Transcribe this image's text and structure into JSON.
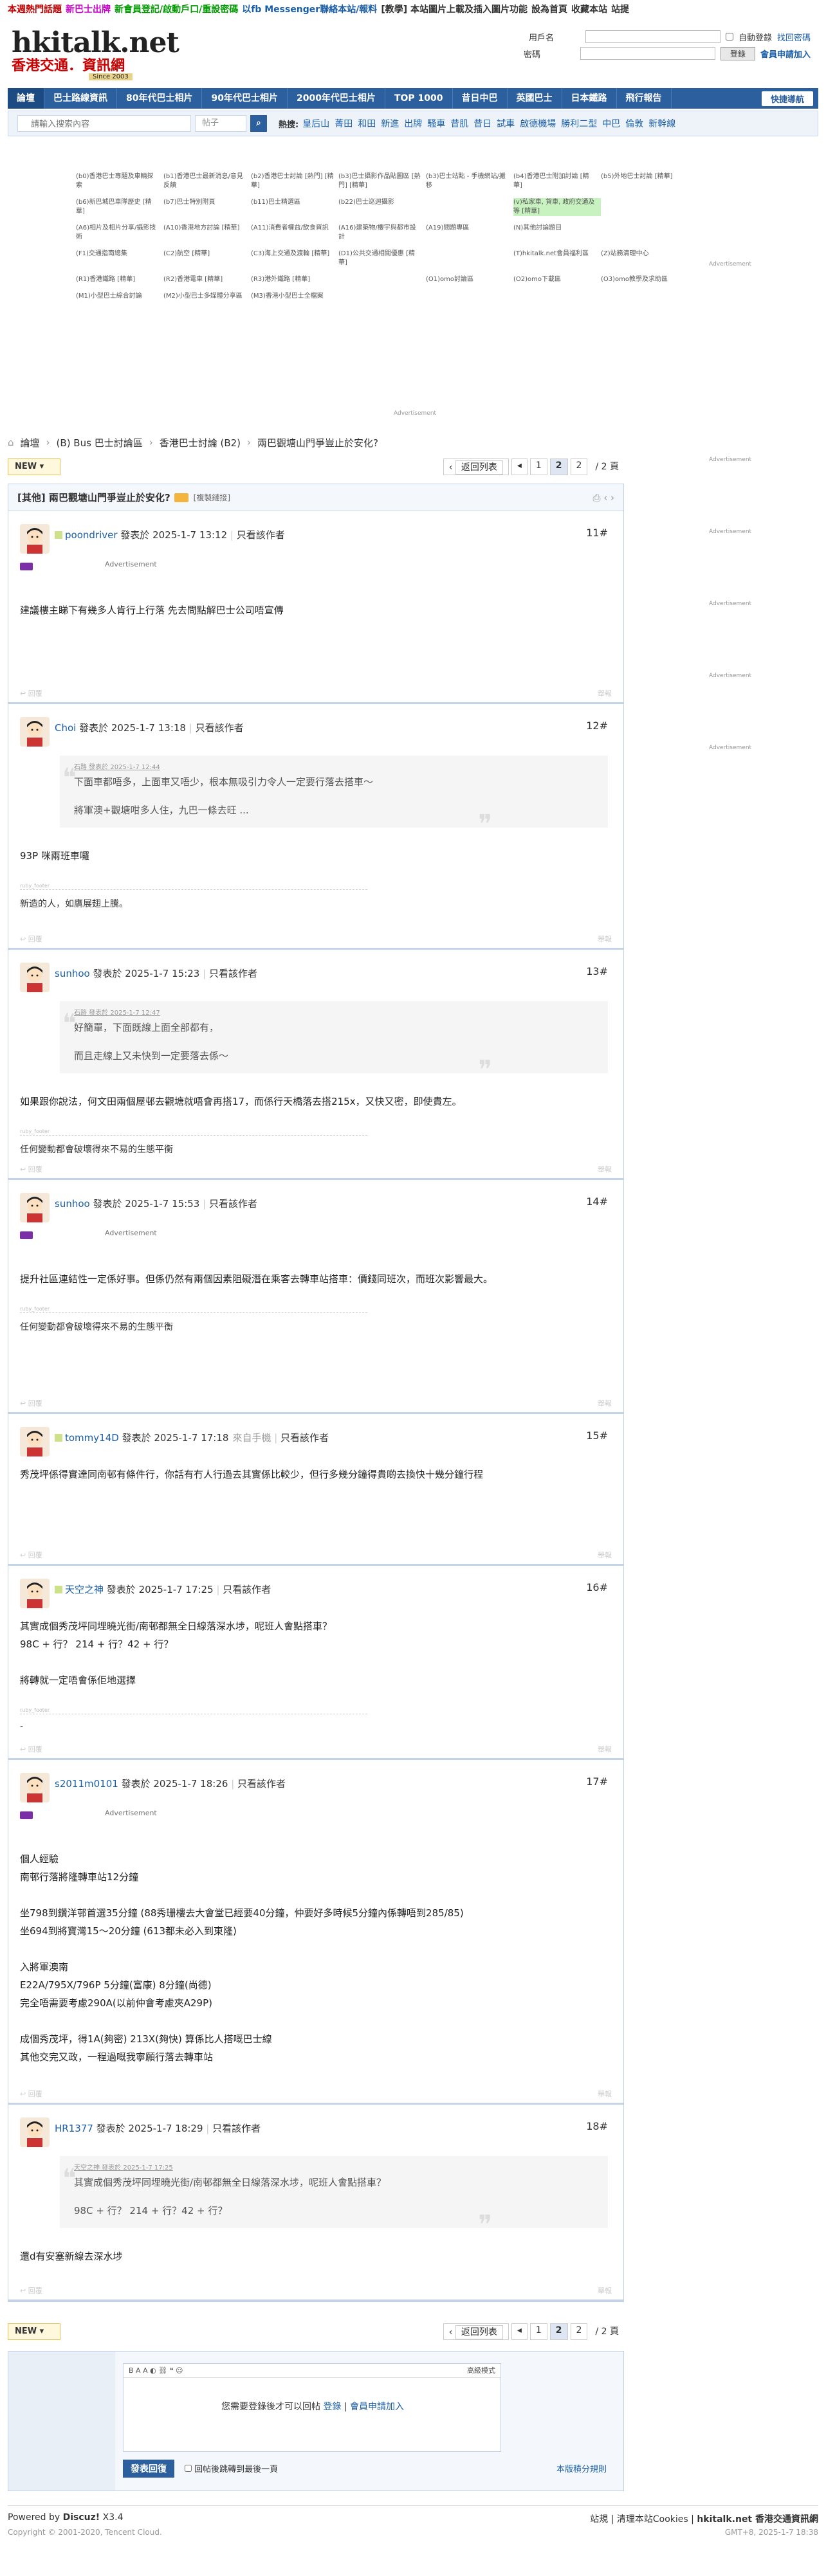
{
  "topbar": {
    "items": [
      {
        "text": "本週熱門話題",
        "color": "#c00000"
      },
      {
        "text": "新巴士出牌",
        "color": "#cc00cc"
      },
      {
        "text": "新會員登記/啟動戶口/重設密碼",
        "color": "#009900"
      },
      {
        "text": "以fb Messenger聯絡本站/報料",
        "color": "#1a5ea8"
      },
      {
        "text": "[教學] 本站圖片上載及插入圖片功能",
        "color": "#333333"
      },
      {
        "text": "設為首頁",
        "color": "#333333"
      },
      {
        "text": "收藏本站",
        "color": "#333333"
      },
      {
        "text": "站提",
        "color": "#333333"
      }
    ]
  },
  "header": {
    "logo_main": "hkitalk.net",
    "logo_sub": "香港交通．資訊網",
    "logo_since": "Since 2003"
  },
  "login": {
    "user_label": "用戶名",
    "pass_label": "密碼",
    "auto_login": "自動登錄",
    "find_password": "找回密碼",
    "login_button": "登錄",
    "register": "會員申請加入"
  },
  "nav": {
    "items": [
      "論壇",
      "巴士路線資訊",
      "80年代巴士相片",
      "90年代巴士相片",
      "2000年代巴士相片",
      "TOP 1000",
      "昔日中巴",
      "英國巴士",
      "日本鐵路",
      "飛行報告"
    ],
    "quick": "快捷導航"
  },
  "search": {
    "placeholder": "請輸入搜索內容",
    "type": "帖子",
    "hot_label": "熱搜:",
    "hot_words": [
      "皇后山",
      "菁田",
      "和田",
      "新進",
      "出牌",
      "騷車",
      "昔肌",
      "昔日",
      "試車",
      "啟德機場",
      "勝利二型",
      "中巴",
      "倫敦",
      "新幹線"
    ]
  },
  "forum_grid": [
    [
      "(b0)香港巴士專題及車輛探索",
      "(b1)香港巴士最新消息/意見反饋",
      "(b2)香港巴士討論 [熱門] [精華]",
      "(b3)巴士攝影作品貼圖區 [熱門] [精華]",
      "(b3)巴士站點 - 手機網站/搬移",
      "(b4)香港巴士附加討論 [精華]",
      "(b5)外地巴士討論 [精華]"
    ],
    [
      "(b6)新巴城巴車隊歷史 [精華]",
      "(b7)巴士特別附頁",
      "(b11)巴士精選區",
      "(b22)巴士巡迴攝影",
      "",
      "(v)私家車, 貨車, 政府交通及等 [精華]",
      ""
    ],
    [
      "(A6)相片及相片分享/攝影技術",
      "(A10)香港地方討論 [精華]",
      "(A11)消費者權益/飲食資訊",
      "(A16)建築物/樓宇與都市設計",
      "(A19)問題專區",
      "(N)其他討論題目",
      ""
    ],
    [
      "(F1)交通指南總集",
      "(C2)航空 [精華]",
      "(C3)海上交通及渡輪 [精華]",
      "(D1)公共交通相關優惠 [精華]",
      "",
      "(T)hkitalk.net會員福利區",
      "(Z)站務清理中心"
    ],
    [
      "(R1)香港鐵路 [精華]",
      "(R2)香港電車 [精華]",
      "(R3)港外鐵路 [精華]",
      "",
      "(O1)omo討論區",
      "(O2)omo下載區",
      "(O3)omo教學及求助區"
    ],
    [
      "(M1)小型巴士綜合討論",
      "(M2)小型巴士多媒體分享區",
      "(M3)香港小型巴士全檔案",
      "",
      "",
      "",
      ""
    ]
  ],
  "ads": {
    "label": "Advertisement"
  },
  "breadcrumb": [
    "論壇",
    "(B) Bus 巴士討論區",
    "香港巴士討論 (B2)",
    "兩巴觀塘山門爭豈止於安化?"
  ],
  "pager": {
    "back": "返回列表",
    "pages": [
      "1",
      "2"
    ],
    "current": "2",
    "total": "/ 2 頁",
    "new_label": "NEW"
  },
  "thread": {
    "category": "[其他]",
    "title": "兩巴觀塘山門爭豈止於安化?",
    "copy_link": "[複製鏈接]"
  },
  "posts": [
    {
      "user": "poondriver",
      "date": "發表於 2025-1-7 13:12",
      "only_author": "只看該作者",
      "floor": "11#",
      "ad": "Advertisement",
      "lines": [
        "建議樓主睇下有幾多人肯行上行落 先去問點解巴士公司唔宣傳"
      ],
      "foot_left": "回覆",
      "foot_right": "舉報"
    },
    {
      "user": "Choi",
      "date": "發表於 2025-1-7 13:18",
      "only_author": "只看該作者",
      "floor": "12#",
      "quote_head": "石路 發表於 2025-1-7 12:44",
      "quote": [
        "下面車都唔多，上面車又唔少，根本無吸引力令人一定要行落去搭車～",
        "將軍澳+觀塘咁多人住，九巴一條去旺 ..."
      ],
      "lines": [
        "93P 咪兩班車囉"
      ],
      "sig_head": "ruby_footer",
      "sig": "新造的人，如鷹展翅上騰。",
      "foot_left": "回覆",
      "foot_right": "舉報"
    },
    {
      "user": "sunhoo",
      "date": "發表於 2025-1-7 15:23",
      "only_author": "只看該作者",
      "floor": "13#",
      "quote_head": "石路 發表於 2025-1-7 12:47",
      "quote": [
        "好簡單，下面既線上面全部都有，",
        "而且走線上又未快到一定要落去係～"
      ],
      "lines": [
        "如果跟你說法，何文田兩個屋邨去觀塘就唔會再搭17，而係行天橋落去搭215x，又快又密，即使貴左。"
      ],
      "sig_head": "ruby_footer",
      "sig": "任何變動都會破壞得來不易的生態平衡",
      "foot_left": "回覆",
      "foot_right": "舉報"
    },
    {
      "user": "sunhoo",
      "date": "發表於 2025-1-7 15:53",
      "only_author": "只看該作者",
      "floor": "14#",
      "ad": "Advertisement",
      "lines": [
        "提升社區連結性一定係好事。但係仍然有兩個因素阻礙潛在乘客去轉車站搭車：價錢同班次，而班次影響最大。"
      ],
      "sig_head": "ruby_footer",
      "sig": "任何變動都會破壞得來不易的生態平衡",
      "foot_left": "回覆",
      "foot_right": "舉報"
    },
    {
      "user": "tommy14D",
      "date": "發表於 2025-1-7 17:18",
      "via": "來自手機",
      "only_author": "只看該作者",
      "floor": "15#",
      "lines": [
        "秀茂坪係得實達同南邨有條件行，你話有冇人行過去其實係比較少，但行多幾分鐘得貴啲去換快十幾分鐘行程"
      ],
      "foot_left": "回覆",
      "foot_right": "舉報"
    },
    {
      "user": "天空之神",
      "date": "發表於 2025-1-7 17:25",
      "only_author": "只看該作者",
      "floor": "16#",
      "lines": [
        "其實成個秀茂坪同埋曉光街/南邨都無全日線落深水埗，呢班人會點搭車？",
        "98C + 行？ 214 + 行？42 + 行？",
        "",
        "將轉就一定唔會係佢地選擇"
      ],
      "sig_head": "ruby_footer",
      "sig": "-",
      "foot_left": "回覆",
      "foot_right": "舉報"
    },
    {
      "user": "s2011m0101",
      "date": "發表於 2025-1-7 18:26",
      "only_author": "只看該作者",
      "floor": "17#",
      "ad": "Advertisement",
      "lines": [
        "個人經驗",
        "南邨行落將隆轉車站12分鐘",
        "",
        "坐798到鑽洋邨首選35分鐘 (88秀珊樓去大會堂已經要40分鐘，仲要好多時候5分鐘內係轉唔到285/85)",
        "坐694到將寶灣15～20分鐘 (613都未必入到東隆)",
        "",
        "入將軍澳南",
        "E22A/795X/796P 5分鐘(富康) 8分鐘(尚德)",
        "完全唔需要考慮290A(以前仲會考慮夾A29P)",
        "",
        "成個秀茂坪，得1A(夠密) 213X(夠快) 算係比人搭嘅巴士線",
        "其他交完又政，一程過嘅我寧願行落去轉車站"
      ],
      "foot_left": "回覆",
      "foot_right": "舉報"
    },
    {
      "user": "HR1377",
      "date": "發表於 2025-1-7 18:29",
      "only_author": "只看該作者",
      "floor": "18#",
      "quote_head": "天空之神 發表於 2025-1-7 17:25",
      "quote": [
        "其實成個秀茂坪同埋曉光街/南邨都無全日線落深水埗，呢班人會點搭車？",
        "98C + 行？ 214 + 行？42 + 行？"
      ],
      "lines": [
        "還d有安塞新線去深水埗"
      ],
      "foot_left": "回覆",
      "foot_right": "舉報"
    }
  ],
  "reply": {
    "advanced": "高級模式",
    "notice": "您需要登錄後才可以回帖",
    "login": "登錄",
    "sep": "|",
    "register": "會員申請加入",
    "send": "發表回復",
    "jump": "回帖後跳轉到最後一頁",
    "rules": "本版積分規則"
  },
  "footer": {
    "powered": "Powered by",
    "brand": "Discuz!",
    "version": "X3.4",
    "copyright": "Copyright © 2001-2020, Tencent Cloud.",
    "links": [
      "站規",
      "清理本站Cookies",
      "hkitalk.net 香港交通資訊網"
    ],
    "time": "GMT+8, 2025-1-7 18:38"
  }
}
